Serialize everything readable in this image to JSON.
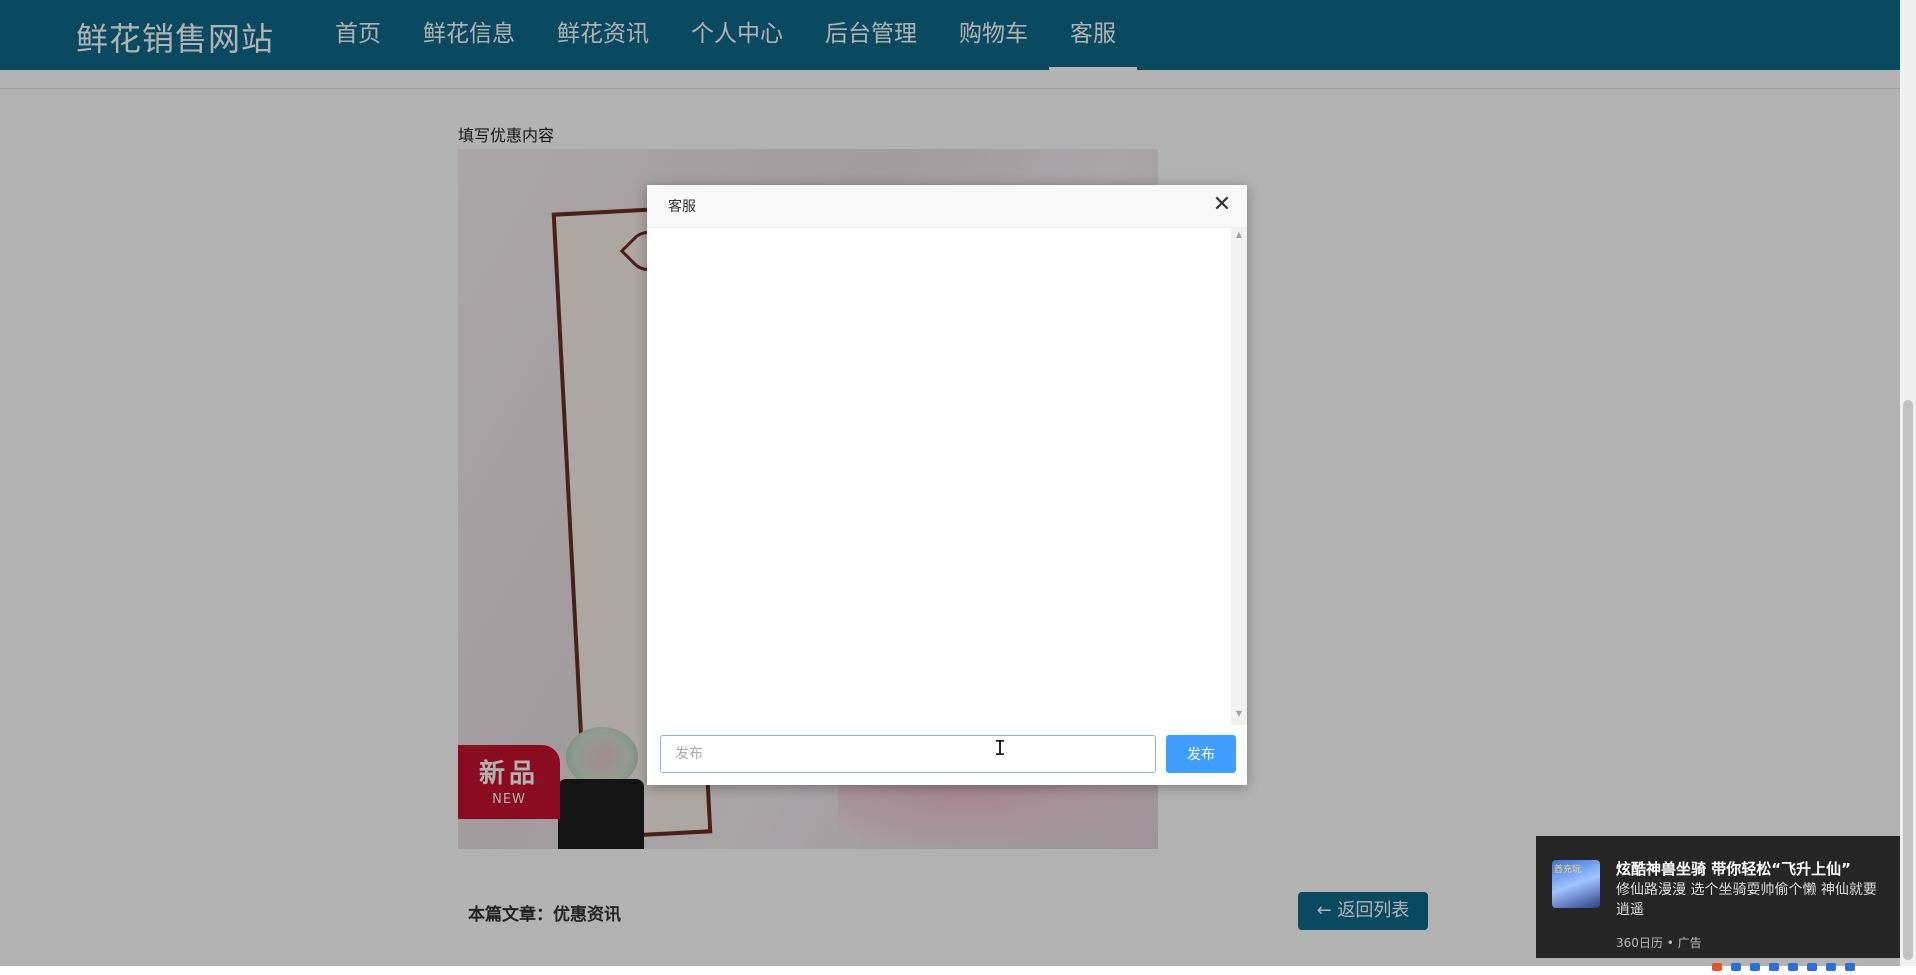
{
  "header": {
    "brand": "鲜花销售网站",
    "nav": [
      {
        "label": "首页"
      },
      {
        "label": "鲜花信息"
      },
      {
        "label": "鲜花资讯"
      },
      {
        "label": "个人中心"
      },
      {
        "label": "后台管理"
      },
      {
        "label": "购物车"
      },
      {
        "label": "客服",
        "active": true
      }
    ]
  },
  "article": {
    "caption": "填写优惠内容",
    "image_badge": {
      "cn": "新品",
      "en": "NEW"
    },
    "footer_label": "本篇文章：优惠资讯",
    "back_button": "返回列表",
    "back_icon": "arrow-left-icon"
  },
  "dialog": {
    "title": "客服",
    "close_icon": "close-icon",
    "input_placeholder": "发布",
    "input_value": "",
    "send_label": "发布"
  },
  "ad": {
    "thumb_tag": "首充玩",
    "title": "炫酷神兽坐骑 带你轻松“飞升上仙”",
    "body": "修仙路漫漫 选个坐骑耍帅偷个懒 神仙就要逍遥",
    "meta": "360日历 • 广告"
  },
  "colors": {
    "header_bg": "#0e6a8c",
    "primary": "#409eff",
    "badge_red": "#c8102e"
  }
}
